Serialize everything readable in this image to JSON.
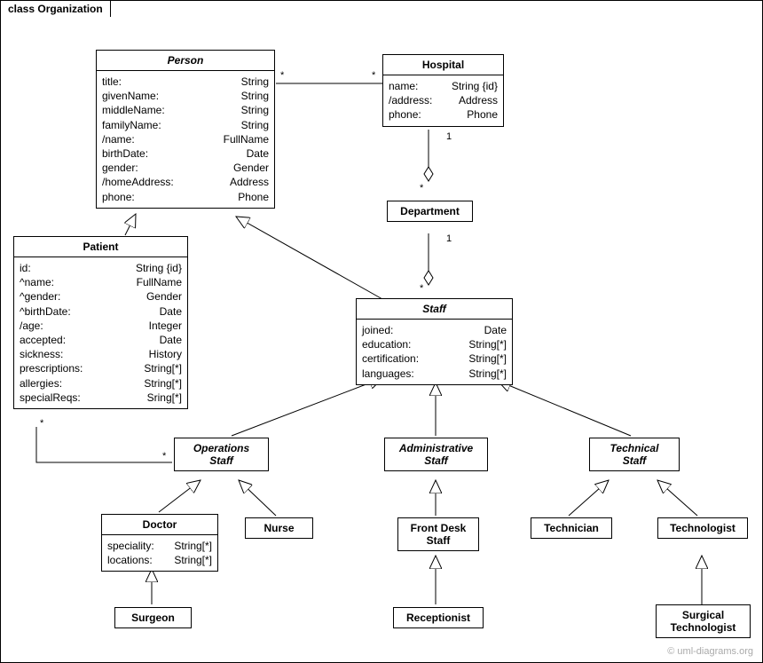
{
  "frame": {
    "title": "class Organization"
  },
  "watermark": "© uml-diagrams.org",
  "classes": {
    "person": {
      "name": "Person",
      "italic": true,
      "attrs": [
        {
          "n": "title:",
          "t": "String"
        },
        {
          "n": "givenName:",
          "t": "String"
        },
        {
          "n": "middleName:",
          "t": "String"
        },
        {
          "n": "familyName:",
          "t": "String"
        },
        {
          "n": "/name:",
          "t": "FullName"
        },
        {
          "n": "birthDate:",
          "t": "Date"
        },
        {
          "n": "gender:",
          "t": "Gender"
        },
        {
          "n": "/homeAddress:",
          "t": "Address"
        },
        {
          "n": "phone:",
          "t": "Phone"
        }
      ]
    },
    "hospital": {
      "name": "Hospital",
      "italic": false,
      "attrs": [
        {
          "n": "name:",
          "t": "String {id}"
        },
        {
          "n": "/address:",
          "t": "Address"
        },
        {
          "n": "phone:",
          "t": "Phone"
        }
      ]
    },
    "patient": {
      "name": "Patient",
      "italic": false,
      "attrs": [
        {
          "n": "id:",
          "t": "String {id}"
        },
        {
          "n": "^name:",
          "t": "FullName"
        },
        {
          "n": "^gender:",
          "t": "Gender"
        },
        {
          "n": "^birthDate:",
          "t": "Date"
        },
        {
          "n": "/age:",
          "t": "Integer"
        },
        {
          "n": "accepted:",
          "t": "Date"
        },
        {
          "n": "sickness:",
          "t": "History"
        },
        {
          "n": "prescriptions:",
          "t": "String[*]"
        },
        {
          "n": "allergies:",
          "t": "String[*]"
        },
        {
          "n": "specialReqs:",
          "t": "Sring[*]"
        }
      ]
    },
    "department": {
      "name": "Department",
      "italic": false,
      "attrs": []
    },
    "staff": {
      "name": "Staff",
      "italic": true,
      "attrs": [
        {
          "n": "joined:",
          "t": "Date"
        },
        {
          "n": "education:",
          "t": "String[*]"
        },
        {
          "n": "certification:",
          "t": "String[*]"
        },
        {
          "n": "languages:",
          "t": "String[*]"
        }
      ]
    },
    "operationsStaff": {
      "name": "Operations\nStaff",
      "italic": true,
      "attrs": []
    },
    "adminStaff": {
      "name": "Administrative\nStaff",
      "italic": true,
      "attrs": []
    },
    "techStaff": {
      "name": "Technical\nStaff",
      "italic": true,
      "attrs": []
    },
    "doctor": {
      "name": "Doctor",
      "italic": false,
      "attrs": [
        {
          "n": "speciality:",
          "t": "String[*]"
        },
        {
          "n": "locations:",
          "t": "String[*]"
        }
      ]
    },
    "nurse": {
      "name": "Nurse"
    },
    "frontDesk": {
      "name": "Front Desk\nStaff"
    },
    "technician": {
      "name": "Technician"
    },
    "technologist": {
      "name": "Technologist"
    },
    "surgeon": {
      "name": "Surgeon"
    },
    "receptionist": {
      "name": "Receptionist"
    },
    "surgTech": {
      "name": "Surgical\nTechnologist"
    }
  },
  "mults": {
    "person_star": "*",
    "hosp_star": "*",
    "hosp_one": "1",
    "dept_star": "*",
    "dept_one": "1",
    "staff_star": "*",
    "patient_star": "*",
    "ops_star": "*"
  }
}
